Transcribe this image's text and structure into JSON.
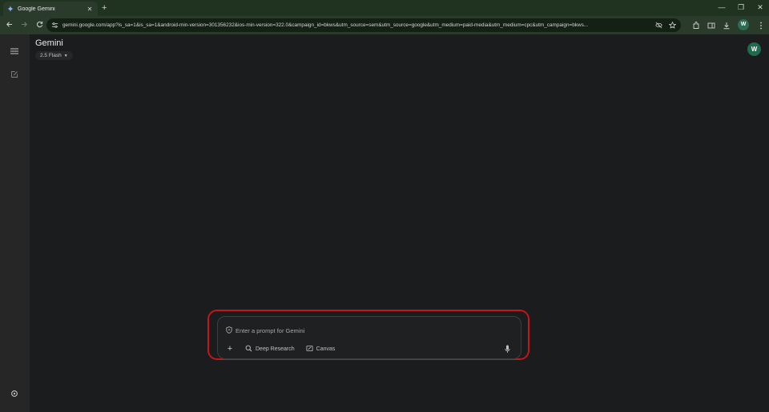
{
  "browser": {
    "tab_title": "Google Gemini",
    "tab_close": "✕",
    "new_tab": "+",
    "url": "gemini.google.com/app?is_sa=1&is_sa=1&android-min-version=301356232&ios-min-version=322.0&campaign_id=bkws&utm_source=sem&utm_source=google&utm_medium=paid-media&utm_medium=cpc&utm_campaign=bkws...",
    "profile_initial": "W",
    "window": {
      "minimize": "—",
      "restore": "❐",
      "close": "✕"
    }
  },
  "app": {
    "title": "Gemini",
    "model": "2.5 Flash",
    "avatar_initial": "W"
  },
  "prompt": {
    "placeholder": "Enter a prompt for Gemini",
    "add": "+",
    "chips": [
      {
        "label": "Deep Research"
      },
      {
        "label": "Canvas"
      }
    ]
  },
  "colors": {
    "accent_highlight": "#c4161c",
    "avatar_bg": "#1e6b4d",
    "titlebar": "#1f3320"
  }
}
